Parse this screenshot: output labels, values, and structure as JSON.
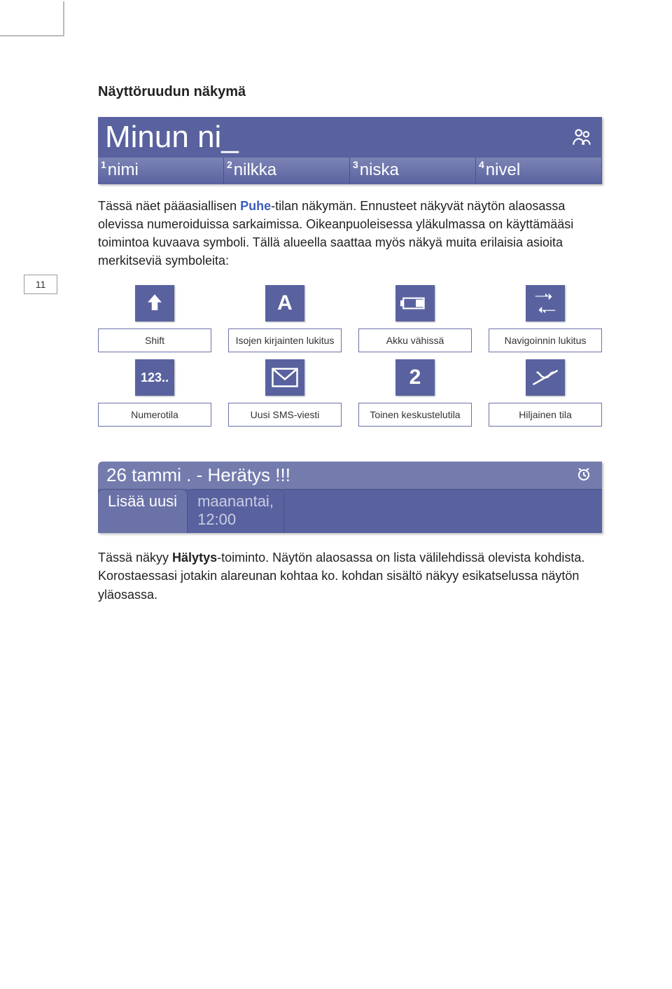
{
  "page_number": "11",
  "heading": "Näyttöruudun näkymä",
  "screen1": {
    "title": "Minun ni_",
    "tabs": [
      {
        "sup": "1",
        "label": "nimi"
      },
      {
        "sup": "2",
        "label": "nilkka"
      },
      {
        "sup": "3",
        "label": "niska"
      },
      {
        "sup": "4",
        "label": "nivel"
      }
    ]
  },
  "paragraph1": {
    "pre": "Tässä näet pääasiallisen ",
    "blue": "Puhe",
    "post": "-tilan näkymän. Ennusteet näkyvät näytön alaosassa olevissa numeroiduissa sarkaimissa. Oikeanpuoleisessa yläkulmassa on käyttämääsi toimintoa kuvaava symboli. Tällä alueella saattaa myös näkyä muita erilaisia asioita merkitseviä symboleita:"
  },
  "icons": {
    "row1": [
      {
        "name": "shift-icon",
        "label": "Shift"
      },
      {
        "name": "capslock-icon",
        "label": "Isojen kirjainten lukitus"
      },
      {
        "name": "battery-low-icon",
        "label": "Akku vähissä"
      },
      {
        "name": "nav-lock-icon",
        "label": "Navigoinnin lukitus"
      }
    ],
    "row2": [
      {
        "name": "numbers-icon",
        "label": "Numerotila",
        "glyph": "123.."
      },
      {
        "name": "sms-icon",
        "label": "Uusi SMS-viesti"
      },
      {
        "name": "second-convo-icon",
        "label": "Toinen keskustelutila",
        "glyph": "2"
      },
      {
        "name": "silent-icon",
        "label": "Hiljainen tila"
      }
    ]
  },
  "screen2": {
    "title": "26 tammi . - Herätys !!!",
    "tabs": [
      {
        "label": "Lisää uusi"
      },
      {
        "lines": [
          "maanantai,",
          "12:00"
        ]
      }
    ]
  },
  "paragraph2": {
    "pre": "Tässä näkyy ",
    "bold": "Hälytys",
    "post": "-toiminto. Näytön alaosassa on lista välilehdissä olevista kohdista.  Korostaessasi jotakin alareunan kohtaa ko. kohdan sisältö näkyy esikatselussa näytön yläosassa."
  }
}
